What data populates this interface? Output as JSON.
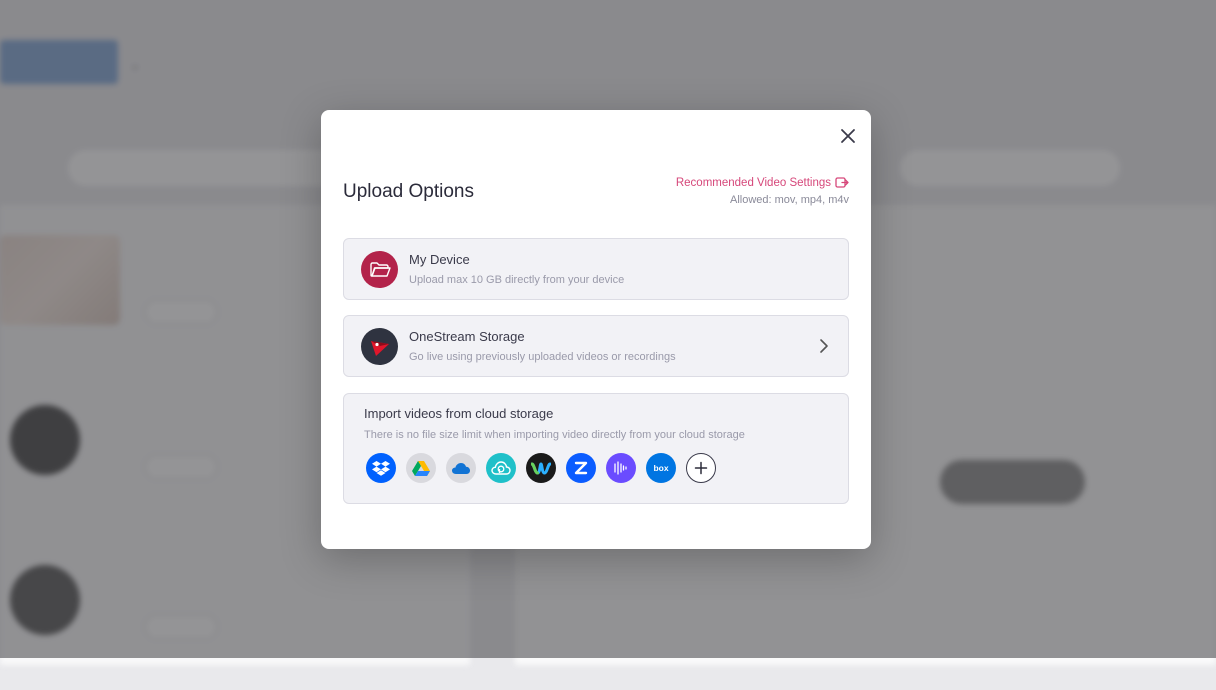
{
  "modal": {
    "title": "Upload Options",
    "recommended_link": "Recommended Video Settings",
    "allowed_formats": "Allowed: mov, mp4, m4v"
  },
  "options": [
    {
      "title": "My Device",
      "subtitle": "Upload max 10 GB directly from your device",
      "icon": "folder-icon",
      "color": "#b3234a"
    },
    {
      "title": "OneStream Storage",
      "subtitle": "Go live using previously uploaded videos or recordings",
      "icon": "onestream-logo-icon",
      "color": "#2f3340"
    }
  ],
  "cloud": {
    "title": "Import videos from cloud storage",
    "subtitle": "There is no file size limit when importing video directly from your cloud storage",
    "providers": [
      {
        "name": "dropbox-icon",
        "color": "#0061fe"
      },
      {
        "name": "google-drive-icon",
        "color": "#d9d9de"
      },
      {
        "name": "onedrive-icon",
        "color": "#d9d9de"
      },
      {
        "name": "pcloud-icon",
        "color": "#1fc0c9"
      },
      {
        "name": "webex-icon",
        "color": "#1a1a1a"
      },
      {
        "name": "zoom-icon",
        "color": "#0b5cff"
      },
      {
        "name": "audio-wave-icon",
        "color": "#6a4cff"
      },
      {
        "name": "box-icon",
        "color": "#0075e2"
      },
      {
        "name": "add-more-icon",
        "color": "#ffffff"
      }
    ]
  },
  "colors": {
    "accent": "#d6477a"
  }
}
